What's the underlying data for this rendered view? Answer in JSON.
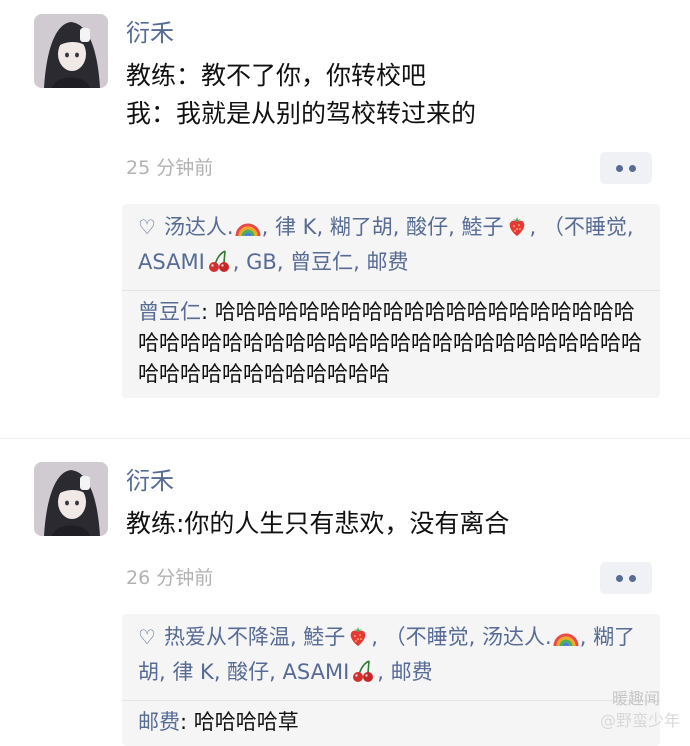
{
  "posts": [
    {
      "author": "衍禾",
      "lines": [
        "教练：教不了你，你转校吧",
        "我：我就是从别的驾校转过来的"
      ],
      "time": "25 分钟前",
      "likes": [
        {
          "name": "汤达人.",
          "emoji": "rainbow"
        },
        {
          "name": "律 K"
        },
        {
          "name": "糊了胡"
        },
        {
          "name": "酸仔"
        },
        {
          "name": "鯥子",
          "emoji": "strawberry"
        },
        {
          "name": "（不睡觉"
        },
        {
          "name": "ASAMI",
          "emoji": "cherries"
        },
        {
          "name": "GB"
        },
        {
          "name": "曾豆仁"
        },
        {
          "name": "邮费"
        }
      ],
      "comment": {
        "name": "曾豆仁",
        "sep": ": ",
        "text": "哈哈哈哈哈哈哈哈哈哈哈哈哈哈哈哈哈哈哈哈哈哈哈哈哈哈哈哈哈哈哈哈哈哈哈哈哈哈哈哈哈哈哈哈哈哈哈哈哈哈哈哈哈哈哈哈"
      }
    },
    {
      "author": "衍禾",
      "lines": [
        "教练:你的人生只有悲欢，没有离合"
      ],
      "time": "26 分钟前",
      "likes": [
        {
          "name": "热爱从不降温"
        },
        {
          "name": "鯥子",
          "emoji": "strawberry"
        },
        {
          "name": "（不睡觉"
        },
        {
          "name": "汤达人.",
          "emoji": "rainbow"
        },
        {
          "name": "糊了胡"
        },
        {
          "name": "律 K"
        },
        {
          "name": "酸仔"
        },
        {
          "name": "ASAMI",
          "emoji": "cherries"
        },
        {
          "name": "邮费"
        }
      ],
      "comment": {
        "name": "邮费",
        "sep": ": ",
        "text": "哈哈哈哈草"
      }
    }
  ],
  "watermark": {
    "line1": "暖趣闻",
    "line2": "@野蛮少年"
  },
  "colors": {
    "link": "#576b95",
    "panel": "#f5f5f5",
    "time": "#b2b2b2"
  },
  "icons": {
    "like": "heart-outline-icon",
    "more": "more-dots-icon"
  }
}
